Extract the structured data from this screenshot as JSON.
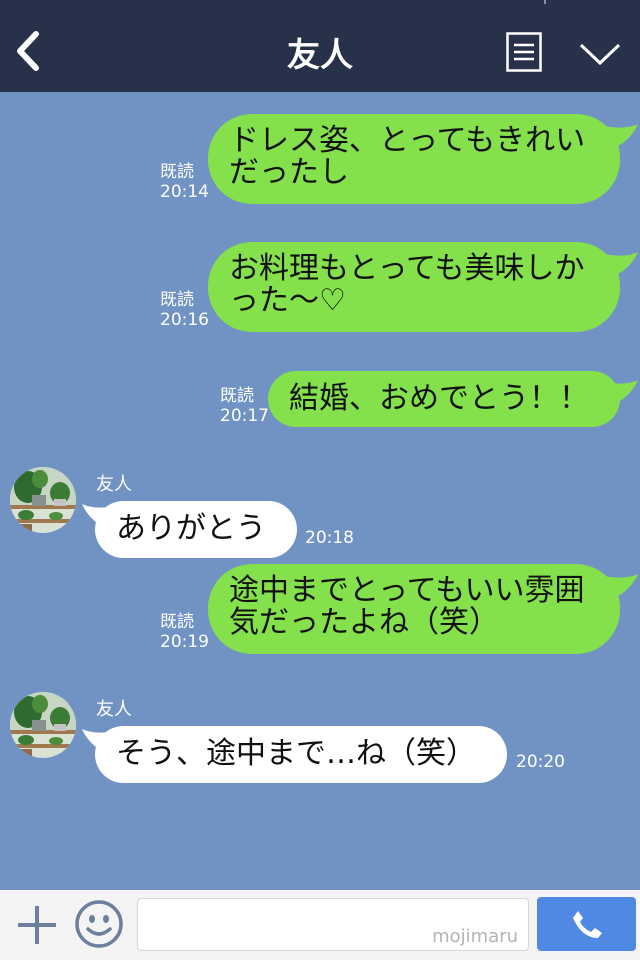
{
  "header": {
    "title": "友人"
  },
  "messages": [
    {
      "text": "ドレス姿、とってもきれいだったし",
      "read": "既読",
      "time": "20:14"
    },
    {
      "text": "お料理もとっても美味しかった〜♡",
      "read": "既読",
      "time": "20:16"
    },
    {
      "text": "結婚、おめでとう！！",
      "read": "既読",
      "time": "20:17"
    },
    {
      "sender": "友人",
      "text": "ありがとう",
      "time": "20:18"
    },
    {
      "text": "途中までとってもいい雰囲気だったよね（笑）",
      "read": "既読",
      "time": "20:19"
    },
    {
      "sender": "友人",
      "text": "そう、途中まで…ね（笑）",
      "time": "20:20"
    }
  ],
  "input": {
    "placeholder": "",
    "watermark": "mojimaru"
  },
  "icons": {
    "back": "chevron-left-icon",
    "note": "note-icon",
    "menu": "chevron-down-icon",
    "plus": "plus-icon",
    "emoji": "smiley-icon",
    "call": "phone-icon"
  },
  "colors": {
    "header_bg": "#27324a",
    "chat_bg": "#7193c3",
    "sent_bubble": "#84e14b",
    "received_bubble": "#ffffff",
    "call_button": "#4f89e3"
  }
}
